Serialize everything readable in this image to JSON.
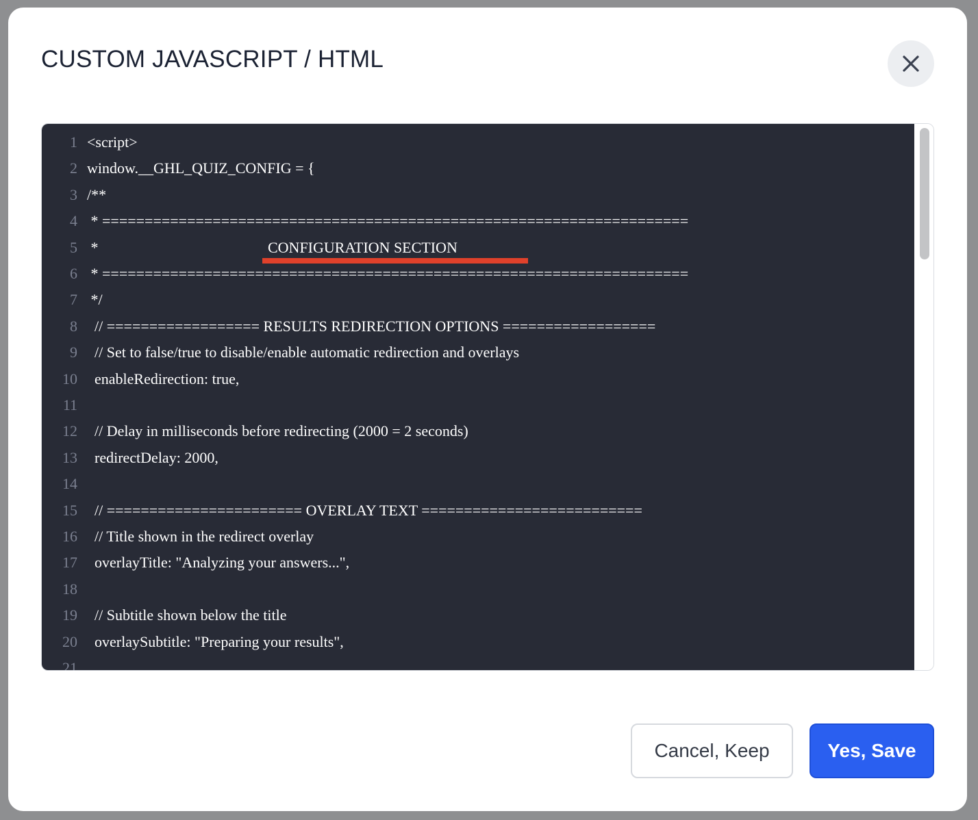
{
  "dialog": {
    "title": "CUSTOM JAVASCRIPT / HTML",
    "close_icon": "close-icon"
  },
  "editor": {
    "lines": [
      {
        "num": "1",
        "text": "<script>"
      },
      {
        "num": "2",
        "text": "window.__GHL_QUIZ_CONFIG = {"
      },
      {
        "num": "3",
        "text": "/**"
      },
      {
        "num": "4",
        "text": " * ====================================================================="
      },
      {
        "num": "5",
        "text": " *                                             CONFIGURATION SECTION"
      },
      {
        "num": "6",
        "text": " * ====================================================================="
      },
      {
        "num": "7",
        "text": " */"
      },
      {
        "num": "8",
        "text": "  // ================== RESULTS REDIRECTION OPTIONS =================="
      },
      {
        "num": "9",
        "text": "  // Set to false/true to disable/enable automatic redirection and overlays"
      },
      {
        "num": "10",
        "text": "  enableRedirection: true,"
      },
      {
        "num": "11",
        "text": ""
      },
      {
        "num": "12",
        "text": "  // Delay in milliseconds before redirecting (2000 = 2 seconds)"
      },
      {
        "num": "13",
        "text": "  redirectDelay: 2000,"
      },
      {
        "num": "14",
        "text": ""
      },
      {
        "num": "15",
        "text": "  // ======================= OVERLAY TEXT =========================="
      },
      {
        "num": "16",
        "text": "  // Title shown in the redirect overlay"
      },
      {
        "num": "17",
        "text": "  overlayTitle: \"Analyzing your answers...\","
      },
      {
        "num": "18",
        "text": ""
      },
      {
        "num": "19",
        "text": "  // Subtitle shown below the title"
      },
      {
        "num": "20",
        "text": "  overlaySubtitle: \"Preparing your results\","
      },
      {
        "num": "21",
        "text": ""
      }
    ]
  },
  "footer": {
    "cancel_label": "Cancel, Keep",
    "save_label": "Yes, Save"
  },
  "colors": {
    "accent": "#2a5ff0",
    "editor_bg": "#282b36",
    "highlight": "#e0412b"
  }
}
